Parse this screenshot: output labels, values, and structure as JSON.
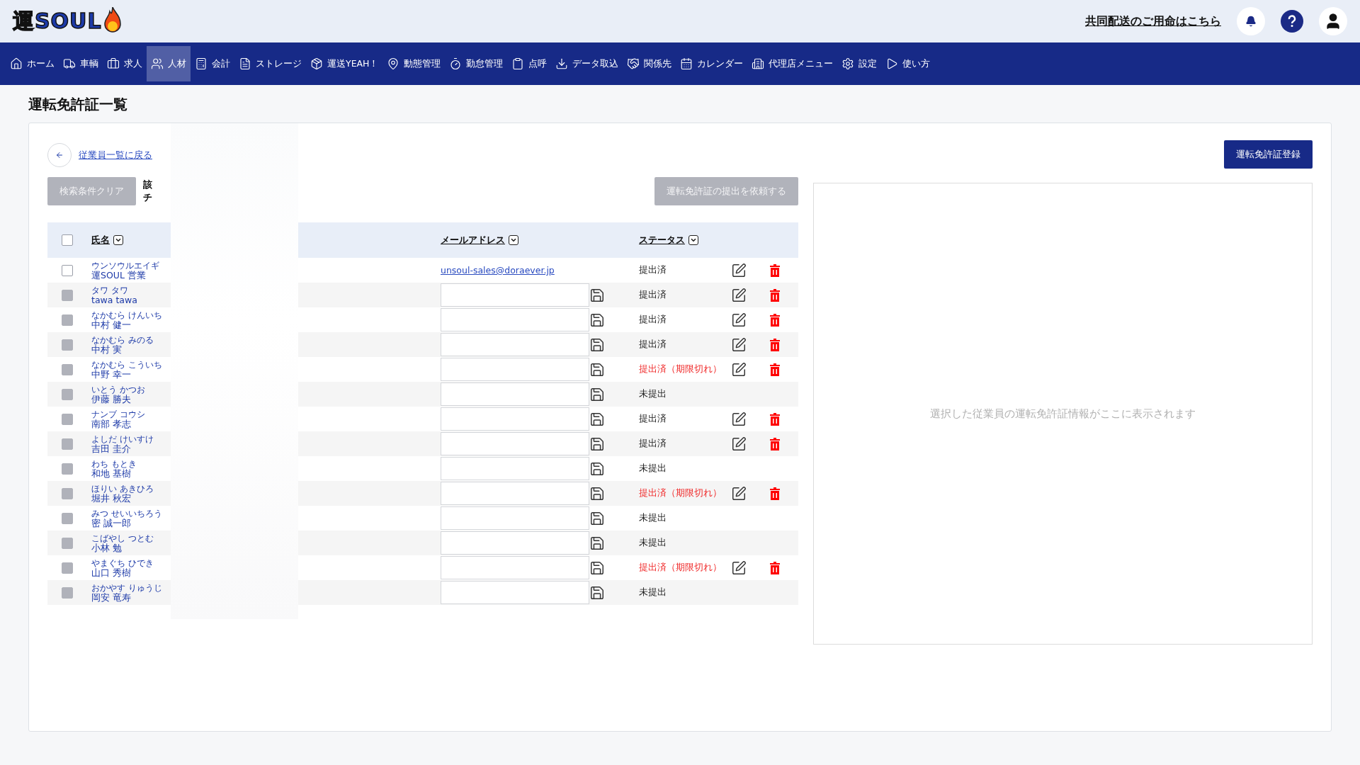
{
  "header": {
    "logo": "運SOUL",
    "link": "共同配送のご用命はこちら"
  },
  "nav": [
    {
      "label": "ホーム",
      "selected": false
    },
    {
      "label": "車輌",
      "selected": false
    },
    {
      "label": "求人",
      "selected": false
    },
    {
      "label": "人材",
      "selected": true
    },
    {
      "label": "会計",
      "selected": false
    },
    {
      "label": "ストレージ",
      "selected": false
    },
    {
      "label": "運送YEAH！",
      "selected": false
    },
    {
      "label": "動態管理",
      "selected": false
    },
    {
      "label": "勤怠管理",
      "selected": false
    },
    {
      "label": "点呼",
      "selected": false
    },
    {
      "label": "データ取込",
      "selected": false
    },
    {
      "label": "関係先",
      "selected": false
    },
    {
      "label": "カレンダー",
      "selected": false
    },
    {
      "label": "代理店メニュー",
      "selected": false
    },
    {
      "label": "設定",
      "selected": false
    },
    {
      "label": "使い方",
      "selected": false
    }
  ],
  "page_title": "運転免許証一覧",
  "back_link": "従業員一覧に戻る",
  "register_button": "運転免許証登録",
  "clear_button": "検索条件クリア",
  "count_lines": [
    "該",
    "チ"
  ],
  "request_button": "運転免許証の提出を依頼する",
  "table": {
    "all_checked": false,
    "columns": [
      "氏名",
      "メールアドレス",
      "ステータス"
    ],
    "rows": [
      {
        "kana": "ウンソウルエイギ",
        "name": "運SOUL 営業",
        "email": "unsoul-sales@doraever.jp",
        "kind": "link",
        "disabled": false,
        "status": "提出済",
        "expired": false,
        "editable": true
      },
      {
        "kana": "タワ タワ",
        "name": "tawa tawa",
        "kind": "input",
        "disabled": true,
        "status": "提出済",
        "expired": false,
        "editable": true
      },
      {
        "kana": "なかむら けんいち",
        "name": "中村 健一",
        "kind": "input",
        "disabled": true,
        "status": "提出済",
        "expired": false,
        "editable": true
      },
      {
        "kana": "なかむら みのる",
        "name": "中村 実",
        "kind": "input",
        "disabled": true,
        "status": "提出済",
        "expired": false,
        "editable": true
      },
      {
        "kana": "なかむら こういち",
        "name": "中野 幸一",
        "kind": "input",
        "disabled": true,
        "status": "提出済（期限切れ）",
        "expired": true,
        "editable": true
      },
      {
        "kana": "いとう かつお",
        "name": "伊藤 勝夫",
        "kind": "input",
        "disabled": true,
        "status": "未提出",
        "expired": false,
        "editable": false
      },
      {
        "kana": "ナンブ コウシ",
        "name": "南部 孝志",
        "kind": "input",
        "disabled": true,
        "status": "提出済",
        "expired": false,
        "editable": true
      },
      {
        "kana": "よしだ けいすけ",
        "name": "吉田 圭介",
        "kind": "input",
        "disabled": true,
        "status": "提出済",
        "expired": false,
        "editable": true
      },
      {
        "kana": "わち もとき",
        "name": "和地 基樹",
        "kind": "input",
        "disabled": true,
        "status": "未提出",
        "expired": false,
        "editable": false
      },
      {
        "kana": "ほりい あきひろ",
        "name": "堀井 秋宏",
        "kind": "input",
        "disabled": true,
        "status": "提出済（期限切れ）",
        "expired": true,
        "editable": true
      },
      {
        "kana": "みつ せいいちろう",
        "name": "密 誠一郎",
        "kind": "input",
        "disabled": true,
        "status": "未提出",
        "expired": false,
        "editable": false
      },
      {
        "kana": "こばやし つとむ",
        "name": "小林 勉",
        "kind": "input",
        "disabled": true,
        "status": "未提出",
        "expired": false,
        "editable": false
      },
      {
        "kana": "やまぐち ひでき",
        "name": "山口 秀樹",
        "kind": "input",
        "disabled": true,
        "status": "提出済（期限切れ）",
        "expired": true,
        "editable": true
      },
      {
        "kana": "おかやす りゅうじ",
        "name": "岡安 竜寿",
        "kind": "input",
        "disabled": true,
        "status": "未提出",
        "expired": false,
        "editable": false
      }
    ]
  },
  "detail_placeholder": "選択した従業員の運転免許証情報がここに表示されます"
}
